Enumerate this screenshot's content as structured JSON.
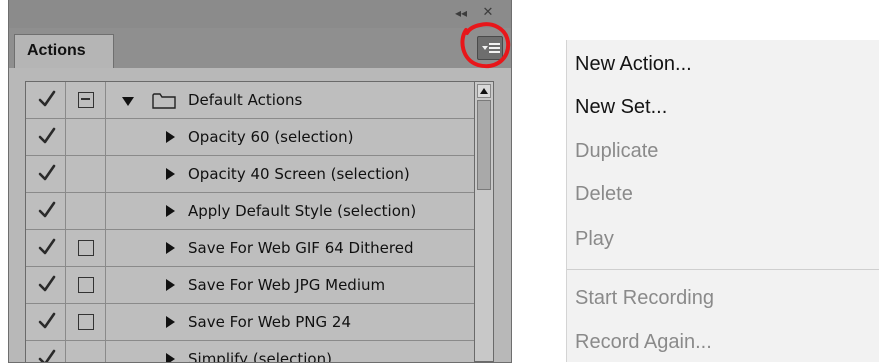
{
  "panel": {
    "tab_label": "Actions",
    "controls": {
      "collapse_glyph": "◂◂",
      "close_glyph": "✕",
      "menu_icon": "panel-menu-icon"
    },
    "rows": [
      {
        "name": "Default Actions",
        "type": "set",
        "checked": true,
        "dialog": "minus",
        "expanded": true
      },
      {
        "name": "Opacity 60 (selection)",
        "type": "action",
        "checked": true,
        "dialog": "none"
      },
      {
        "name": "Opacity 40 Screen (selection)",
        "type": "action",
        "checked": true,
        "dialog": "none"
      },
      {
        "name": "Apply Default Style (selection)",
        "type": "action",
        "checked": true,
        "dialog": "none"
      },
      {
        "name": "Save For Web GIF 64 Dithered",
        "type": "action",
        "checked": true,
        "dialog": "box"
      },
      {
        "name": "Save For Web JPG Medium",
        "type": "action",
        "checked": true,
        "dialog": "box"
      },
      {
        "name": "Save For Web PNG 24",
        "type": "action",
        "checked": true,
        "dialog": "box"
      },
      {
        "name": "Simplify (selection)",
        "type": "action",
        "checked": true,
        "dialog": "none"
      }
    ]
  },
  "flyout": {
    "groups": [
      [
        {
          "label": "New Action...",
          "enabled": true
        },
        {
          "label": "New Set...",
          "enabled": true
        },
        {
          "label": "Duplicate",
          "enabled": false
        },
        {
          "label": "Delete",
          "enabled": false
        },
        {
          "label": "Play",
          "enabled": false
        }
      ],
      [
        {
          "label": "Start Recording",
          "enabled": false
        },
        {
          "label": "Record Again...",
          "enabled": false
        }
      ]
    ]
  },
  "colors": {
    "annotation": "#e8161a",
    "panel_bg": "#b8b8b8",
    "menu_bg": "#f2f2f2"
  }
}
